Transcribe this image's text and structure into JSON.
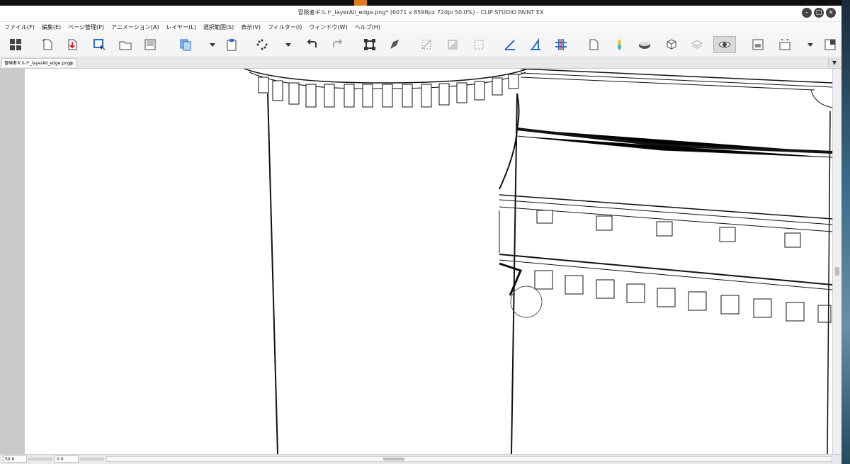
{
  "window": {
    "title": "冒険者ギルド_layerAll_edge.png* (6071 x 8598px 72dpi 50.0%)  - CLIP STUDIO PAINT EX",
    "controls": [
      "minimize",
      "maximize",
      "close"
    ]
  },
  "menu": [
    "ファイル(F)",
    "編集(E)",
    "ページ管理(P)",
    "アニメーション(A)",
    "レイヤー(L)",
    "選択範囲(S)",
    "表示(V)",
    "フィルター(I)",
    "ウィンドウ(W)",
    "ヘルプ(H)"
  ],
  "toolbar": {
    "items": [
      {
        "name": "app-menu-icon"
      },
      {
        "name": "new-icon"
      },
      {
        "name": "import-icon"
      },
      {
        "name": "select-document-icon"
      },
      {
        "name": "open-icon"
      },
      {
        "name": "save-icon"
      },
      {
        "name": "copy-icon"
      },
      {
        "name": "dropdown-icon"
      },
      {
        "name": "paste-icon"
      },
      {
        "name": "transform-dots-icon"
      },
      {
        "name": "dropdown-icon"
      },
      {
        "name": "undo-icon"
      },
      {
        "name": "redo-icon"
      },
      {
        "name": "transform-icon"
      },
      {
        "name": "pen-nib-icon"
      },
      {
        "name": "clear-selection-icon"
      },
      {
        "name": "invert-selection-icon"
      },
      {
        "name": "select-all-icon"
      },
      {
        "name": "ruler-icon"
      },
      {
        "name": "perspective-ruler-icon"
      },
      {
        "name": "grid-icon"
      },
      {
        "name": "page-icon"
      },
      {
        "name": "marker-icon"
      },
      {
        "name": "ellipse-stamp-icon"
      },
      {
        "name": "3d-object-icon"
      },
      {
        "name": "layers-icon"
      },
      {
        "name": "eye-icon"
      },
      {
        "name": "image-icon"
      },
      {
        "name": "frame-icon"
      },
      {
        "name": "dropdown-icon"
      },
      {
        "name": "panel-icon"
      }
    ],
    "active": "eye-icon"
  },
  "document_tab": {
    "label": "冒険者ギルド_layerAll_edge.png*"
  },
  "status": {
    "zoom": "50.0",
    "rotation": "0.0"
  },
  "colors": {
    "canvas_bg": "#c9c9c9",
    "paper": "#ffffff",
    "line": "#111111"
  }
}
